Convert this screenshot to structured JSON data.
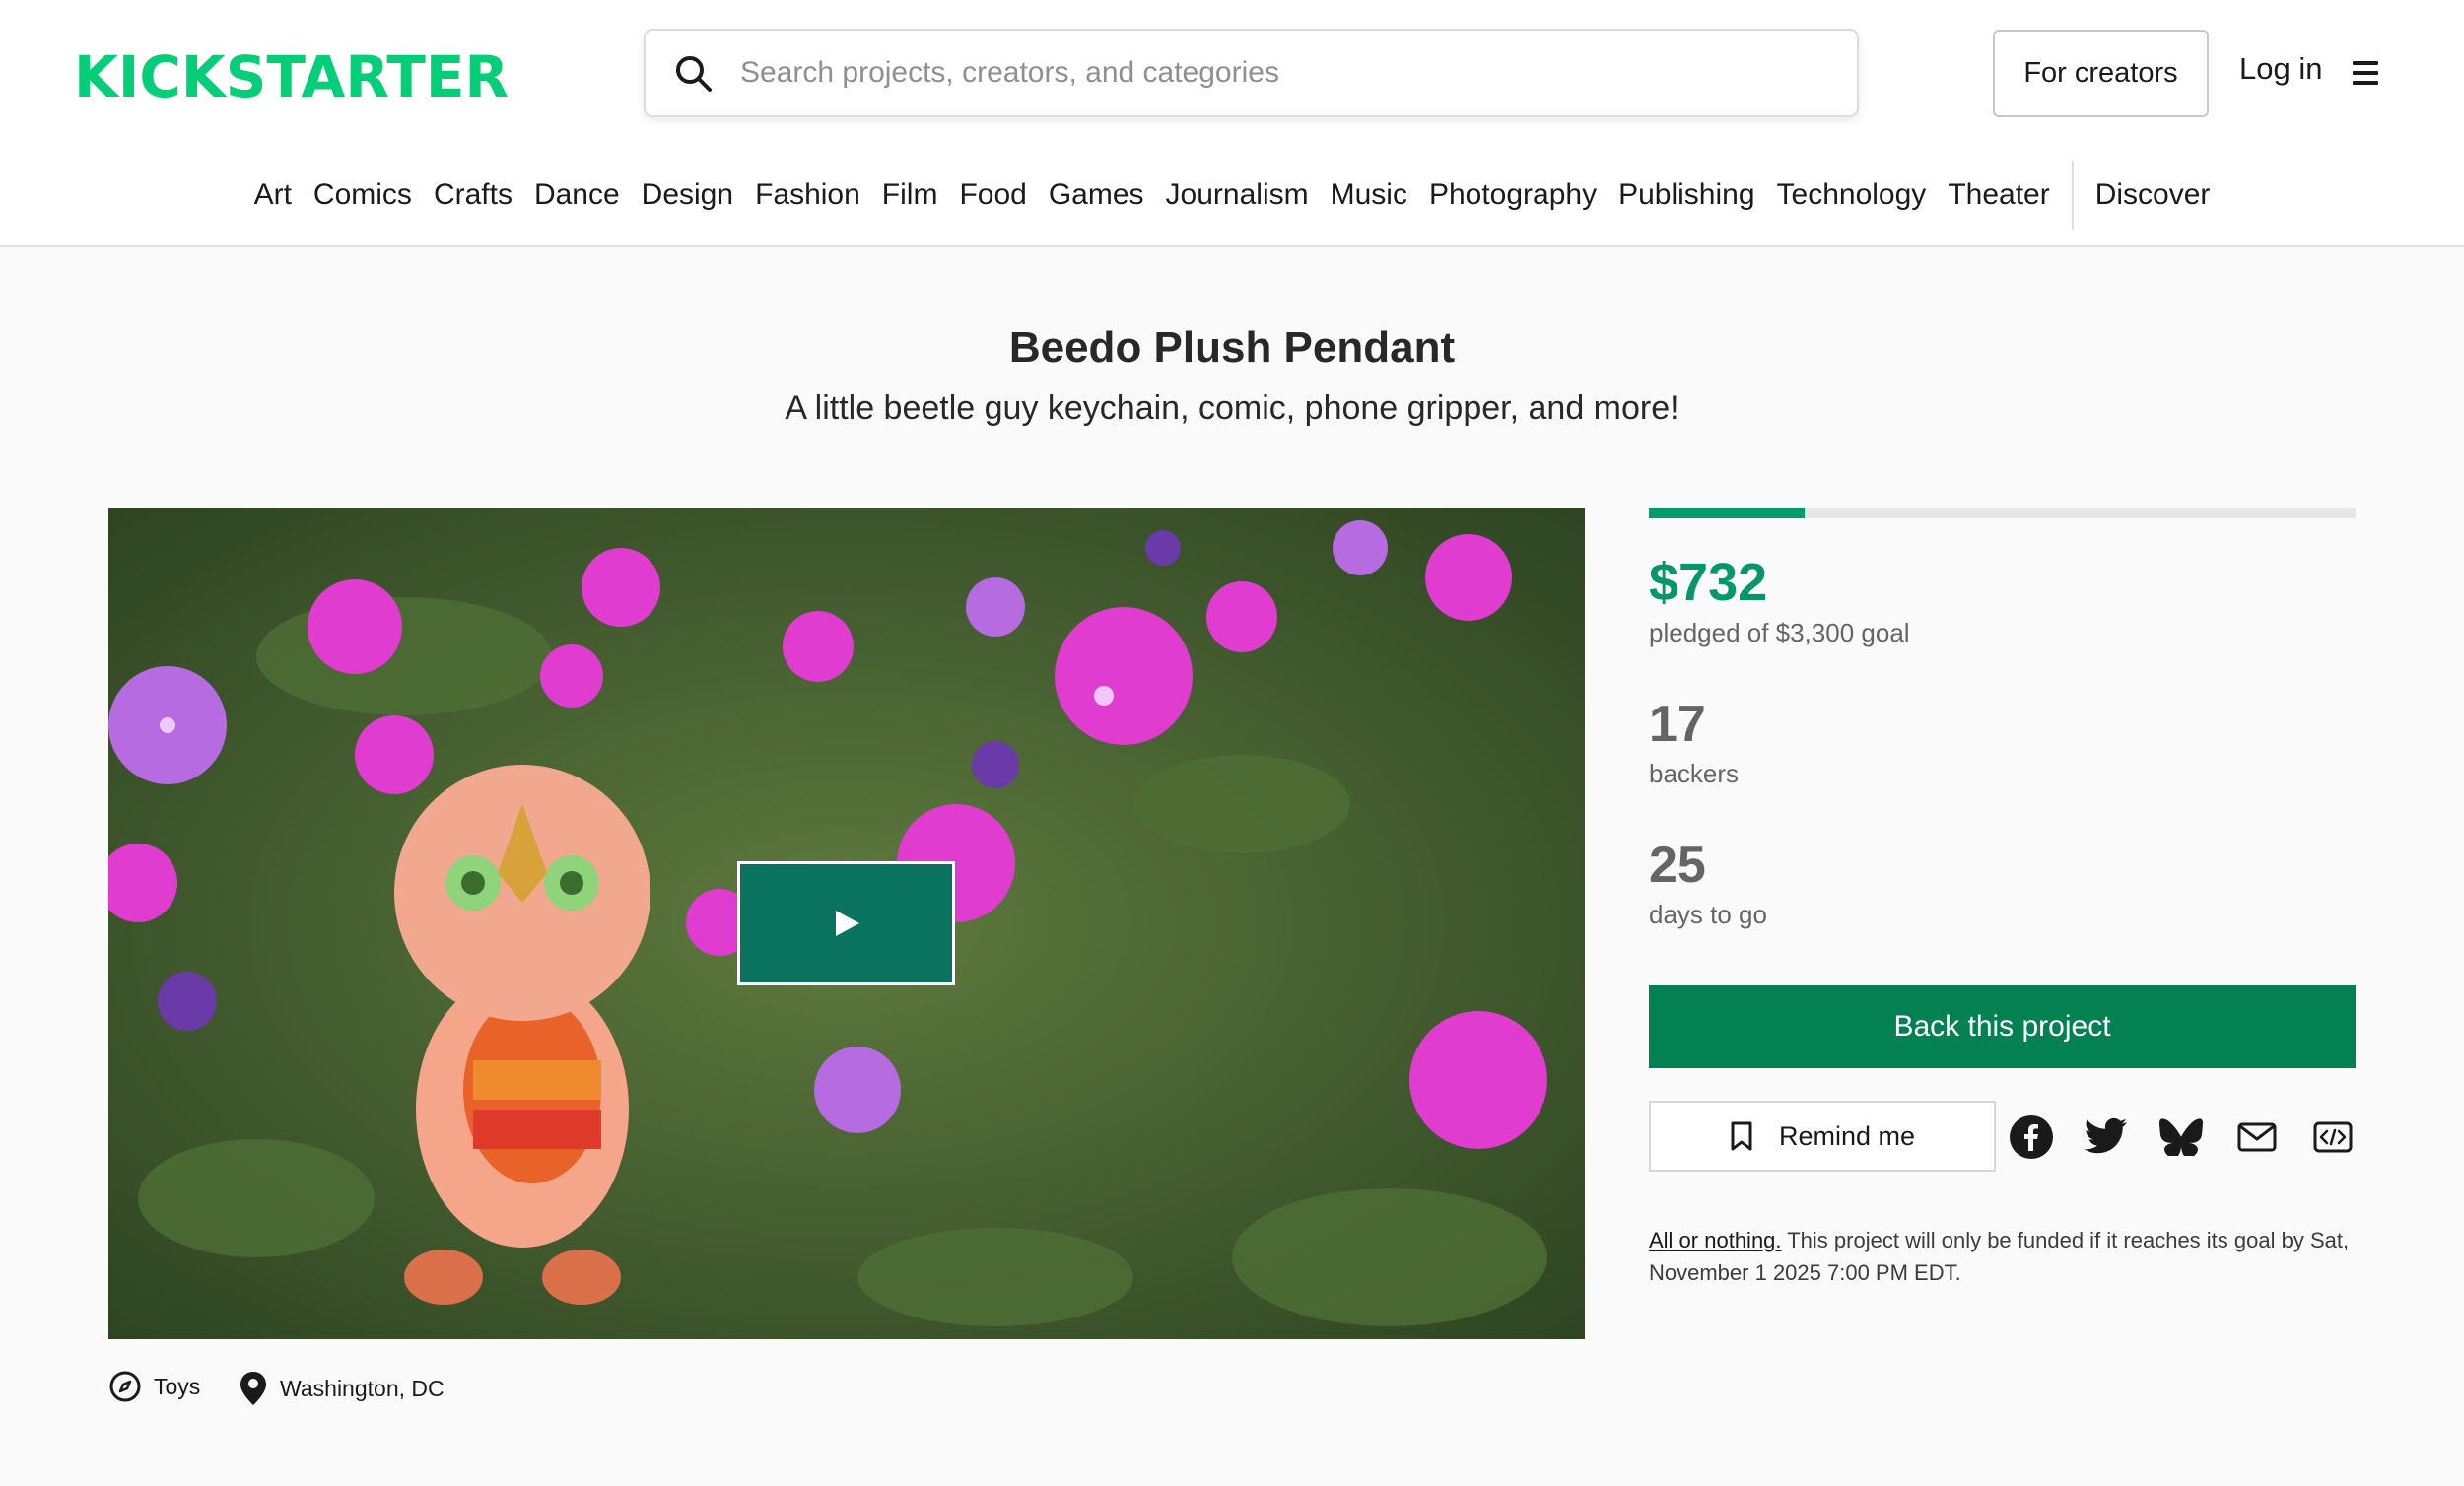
{
  "header": {
    "logo_text": "KICKSTARTER",
    "search_placeholder": "Search projects, creators, and categories",
    "for_creators_label": "For creators",
    "login_label": "Log in"
  },
  "categories": [
    "Art",
    "Comics",
    "Crafts",
    "Dance",
    "Design",
    "Fashion",
    "Film",
    "Food",
    "Games",
    "Journalism",
    "Music",
    "Photography",
    "Publishing",
    "Technology",
    "Theater"
  ],
  "discover_label": "Discover",
  "project": {
    "title": "Beedo Plush Pendant",
    "subtitle": "A little beetle guy keychain, comic, phone gripper, and more!",
    "category": "Toys",
    "location": "Washington, DC"
  },
  "stats": {
    "funded_fraction": 0.22,
    "pledged": "$732",
    "pledged_label": "pledged of $3,300 goal",
    "backers": "17",
    "backers_label": "backers",
    "days": "25",
    "days_label": "days to go"
  },
  "actions": {
    "back_label": "Back this project",
    "remind_label": "Remind me"
  },
  "funding_note": {
    "link": "All or nothing.",
    "text": " This project will only be funded if it reaches its goal by Sat, November 1 2025 7:00 PM EDT."
  },
  "colors": {
    "brand_green": "#05ce78",
    "pledged_green": "#05976c",
    "back_button": "#038152",
    "play_button": "#0a735f"
  },
  "icons": [
    "search-icon",
    "menu-icon",
    "play-icon",
    "compass-icon",
    "location-pin-icon",
    "bookmark-icon",
    "facebook-icon",
    "twitter-icon",
    "bluesky-icon",
    "email-icon",
    "embed-icon"
  ]
}
